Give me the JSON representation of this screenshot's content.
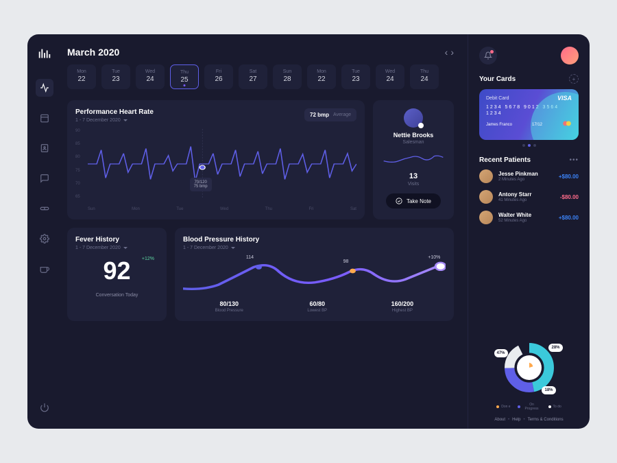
{
  "header": {
    "month": "March 2020"
  },
  "calendar": [
    {
      "dow": "Mon",
      "num": "22"
    },
    {
      "dow": "Tue",
      "num": "23"
    },
    {
      "dow": "Wed",
      "num": "24"
    },
    {
      "dow": "Thu",
      "num": "25",
      "selected": true
    },
    {
      "dow": "Fri",
      "num": "26"
    },
    {
      "dow": "Sat",
      "num": "27"
    },
    {
      "dow": "Sun",
      "num": "28"
    },
    {
      "dow": "Mon",
      "num": "22"
    },
    {
      "dow": "Tue",
      "num": "23"
    },
    {
      "dow": "Wed",
      "num": "24"
    },
    {
      "dow": "Thu",
      "num": "24"
    }
  ],
  "heart": {
    "title": "Performance Heart Rate",
    "subtitle": "1 - 7 December 2020",
    "badge_value": "72 bmp",
    "badge_label": "Average",
    "y_ticks": [
      "90",
      "85",
      "80",
      "75",
      "70",
      "65"
    ],
    "x_ticks": [
      "Sun",
      "Mon",
      "Tue",
      "Wed",
      "Thu",
      "Fri",
      "Sat"
    ],
    "tooltip_line1": "70/120",
    "tooltip_line2": "75 bmp"
  },
  "profile": {
    "name": "Nettie Brooks",
    "role": "Salesman",
    "visits_num": "13",
    "visits_label": "Visits",
    "take_note": "Take Note"
  },
  "fever": {
    "title": "Fever History",
    "subtitle": "1 - 7 December 2020",
    "change": "+12%",
    "value": "92",
    "label": "Conversation Today"
  },
  "bp": {
    "title": "Blood Pressure History",
    "subtitle": "1 - 7 December 2020",
    "peak1": "114",
    "peak2": "98",
    "change": "+10%",
    "stats": [
      {
        "val": "80/130",
        "lbl": "Blood Pressure"
      },
      {
        "val": "60/80",
        "lbl": "Lowest BP"
      },
      {
        "val": "160/200",
        "lbl": "Highest BP"
      }
    ]
  },
  "cards": {
    "title": "Your Cards",
    "type": "Debit Card",
    "brand": "VISA",
    "number": "1234  5678  9012  3564",
    "extra": "1234",
    "name": "James Franco",
    "exp": "17/12"
  },
  "patients": {
    "title": "Recent Patients",
    "list": [
      {
        "name": "Jesse Pinkman",
        "time": "2 Minutes Ago",
        "amount": "+$80.00",
        "positive": true
      },
      {
        "name": "Antony Starr",
        "time": "41 Minutes Ago",
        "amount": "-$80.00",
        "positive": false
      },
      {
        "name": "Walter White",
        "time": "52 Minutes Ago",
        "amount": "+$80.00",
        "positive": true
      }
    ]
  },
  "donut": {
    "badges": [
      "47%",
      "28%",
      "18%"
    ],
    "legend": [
      {
        "color": "#ffa94d",
        "label": "Don e"
      },
      {
        "color": "#5f5fe8",
        "label": "On Progress"
      },
      {
        "color": "#fff",
        "label": "To do"
      }
    ]
  },
  "footer": {
    "about": "About",
    "help": "Help",
    "terms": "Terms & Conditions"
  },
  "chart_data": {
    "heart_rate": {
      "type": "line",
      "x": [
        "Sun",
        "Mon",
        "Tue",
        "Wed",
        "Thu",
        "Fri",
        "Sat"
      ],
      "ylim": [
        65,
        90
      ],
      "title": "Performance Heart Rate",
      "ylabel": "bpm",
      "tooltip": {
        "label": "70/120",
        "value": 75
      }
    },
    "blood_pressure": {
      "type": "line",
      "title": "Blood Pressure History",
      "peaks": [
        114,
        98
      ],
      "change_pct": 10,
      "stats": {
        "blood_pressure": "80/130",
        "lowest": "60/80",
        "highest": "160/200"
      }
    },
    "donut": {
      "type": "pie",
      "series": [
        {
          "name": "Done",
          "value": 47
        },
        {
          "name": "On Progress",
          "value": 28
        },
        {
          "name": "To do",
          "value": 18
        }
      ]
    }
  }
}
